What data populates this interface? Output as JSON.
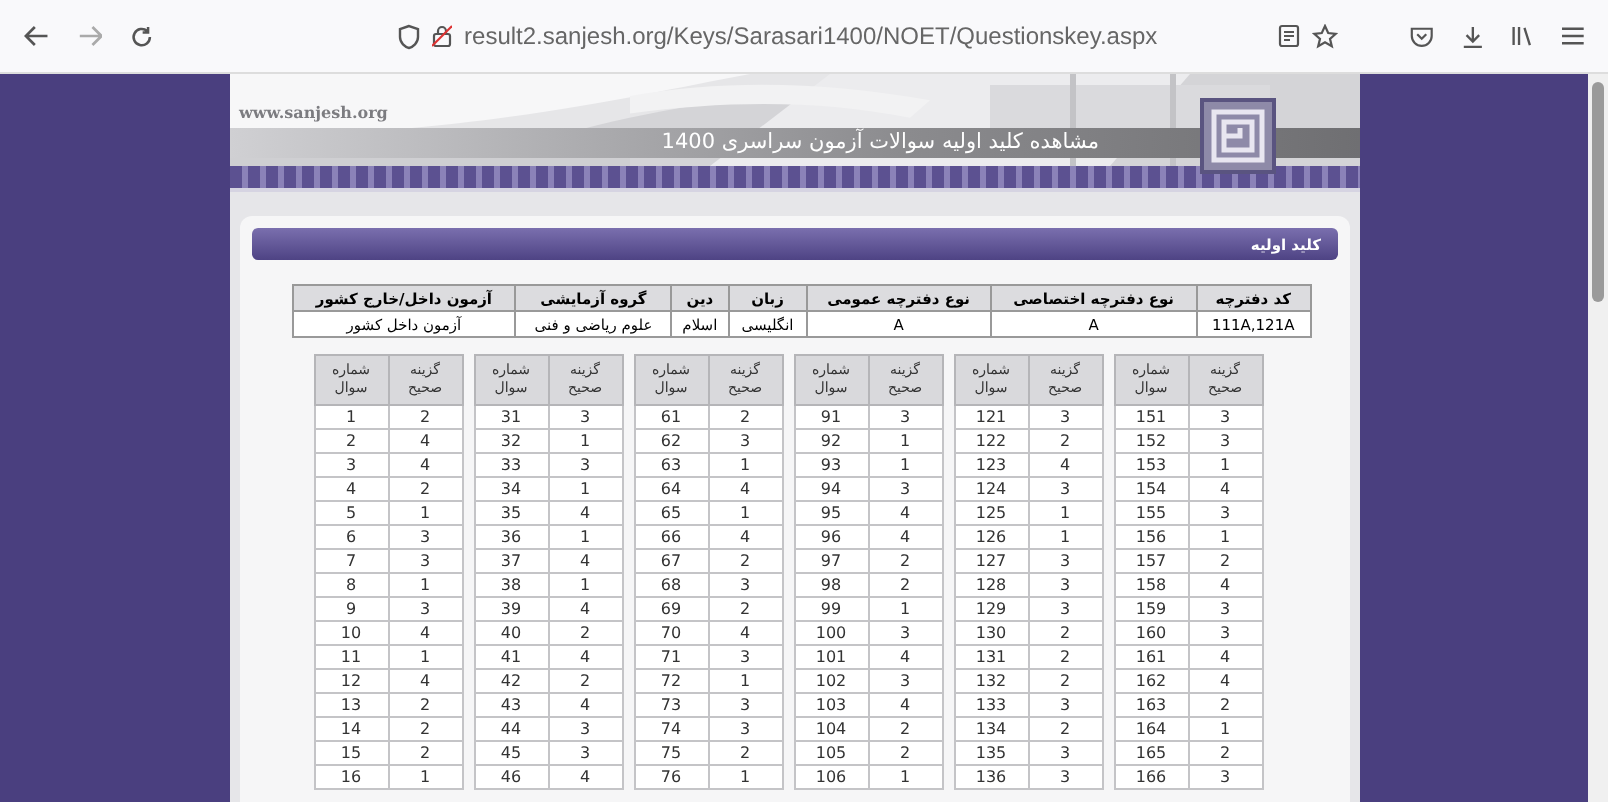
{
  "browser": {
    "url": "result2.sanjesh.org/Keys/Sarasari1400/NOET/Questionskey.aspx"
  },
  "banner": {
    "site": "www.sanjesh.org",
    "title": "مشاهده کلید اولیه سوالات آزمون سراسری 1400"
  },
  "panel": {
    "title": "کلید اولیه"
  },
  "info_table": {
    "columns": [
      "کد دفترچه",
      "نوع دفترچه اختصاصی",
      "نوع دفترچه عمومی",
      "زبان",
      "دین",
      "گروه آزمایشی",
      "آزمون داخل/خارج کشور"
    ],
    "rows": [
      [
        "111A,121A",
        "A",
        "A",
        "انگلیسی",
        "اسلام",
        "علوم ریاضی و فنی",
        "آزمون داخل کشور"
      ]
    ]
  },
  "answer_tables": [
    {
      "columns": [
        "گزینه صحیح",
        "شماره سوال"
      ],
      "rows": [
        [
          "3",
          "151"
        ],
        [
          "3",
          "152"
        ],
        [
          "1",
          "153"
        ],
        [
          "4",
          "154"
        ],
        [
          "3",
          "155"
        ],
        [
          "1",
          "156"
        ],
        [
          "2",
          "157"
        ],
        [
          "4",
          "158"
        ],
        [
          "3",
          "159"
        ],
        [
          "3",
          "160"
        ],
        [
          "4",
          "161"
        ],
        [
          "4",
          "162"
        ],
        [
          "2",
          "163"
        ],
        [
          "1",
          "164"
        ],
        [
          "2",
          "165"
        ],
        [
          "3",
          "166"
        ]
      ]
    },
    {
      "columns": [
        "گزینه صحیح",
        "شماره سوال"
      ],
      "rows": [
        [
          "3",
          "121"
        ],
        [
          "2",
          "122"
        ],
        [
          "4",
          "123"
        ],
        [
          "3",
          "124"
        ],
        [
          "1",
          "125"
        ],
        [
          "1",
          "126"
        ],
        [
          "3",
          "127"
        ],
        [
          "3",
          "128"
        ],
        [
          "3",
          "129"
        ],
        [
          "2",
          "130"
        ],
        [
          "2",
          "131"
        ],
        [
          "2",
          "132"
        ],
        [
          "3",
          "133"
        ],
        [
          "2",
          "134"
        ],
        [
          "3",
          "135"
        ],
        [
          "3",
          "136"
        ]
      ]
    },
    {
      "columns": [
        "گزینه صحیح",
        "شماره سوال"
      ],
      "rows": [
        [
          "3",
          "91"
        ],
        [
          "1",
          "92"
        ],
        [
          "1",
          "93"
        ],
        [
          "3",
          "94"
        ],
        [
          "4",
          "95"
        ],
        [
          "4",
          "96"
        ],
        [
          "2",
          "97"
        ],
        [
          "2",
          "98"
        ],
        [
          "1",
          "99"
        ],
        [
          "3",
          "100"
        ],
        [
          "4",
          "101"
        ],
        [
          "3",
          "102"
        ],
        [
          "4",
          "103"
        ],
        [
          "2",
          "104"
        ],
        [
          "2",
          "105"
        ],
        [
          "1",
          "106"
        ]
      ]
    },
    {
      "columns": [
        "گزینه صحیح",
        "شماره سوال"
      ],
      "rows": [
        [
          "2",
          "61"
        ],
        [
          "3",
          "62"
        ],
        [
          "1",
          "63"
        ],
        [
          "4",
          "64"
        ],
        [
          "1",
          "65"
        ],
        [
          "4",
          "66"
        ],
        [
          "2",
          "67"
        ],
        [
          "3",
          "68"
        ],
        [
          "2",
          "69"
        ],
        [
          "4",
          "70"
        ],
        [
          "3",
          "71"
        ],
        [
          "1",
          "72"
        ],
        [
          "3",
          "73"
        ],
        [
          "3",
          "74"
        ],
        [
          "2",
          "75"
        ],
        [
          "1",
          "76"
        ]
      ]
    },
    {
      "columns": [
        "گزینه صحیح",
        "شماره سوال"
      ],
      "rows": [
        [
          "3",
          "31"
        ],
        [
          "1",
          "32"
        ],
        [
          "3",
          "33"
        ],
        [
          "1",
          "34"
        ],
        [
          "4",
          "35"
        ],
        [
          "1",
          "36"
        ],
        [
          "4",
          "37"
        ],
        [
          "1",
          "38"
        ],
        [
          "4",
          "39"
        ],
        [
          "2",
          "40"
        ],
        [
          "4",
          "41"
        ],
        [
          "2",
          "42"
        ],
        [
          "4",
          "43"
        ],
        [
          "3",
          "44"
        ],
        [
          "3",
          "45"
        ],
        [
          "4",
          "46"
        ]
      ]
    },
    {
      "columns": [
        "گزینه صحیح",
        "شماره سوال"
      ],
      "rows": [
        [
          "2",
          "1"
        ],
        [
          "4",
          "2"
        ],
        [
          "4",
          "3"
        ],
        [
          "2",
          "4"
        ],
        [
          "1",
          "5"
        ],
        [
          "3",
          "6"
        ],
        [
          "3",
          "7"
        ],
        [
          "1",
          "8"
        ],
        [
          "3",
          "9"
        ],
        [
          "4",
          "10"
        ],
        [
          "1",
          "11"
        ],
        [
          "4",
          "12"
        ],
        [
          "2",
          "13"
        ],
        [
          "2",
          "14"
        ],
        [
          "2",
          "15"
        ],
        [
          "1",
          "16"
        ]
      ]
    }
  ]
}
